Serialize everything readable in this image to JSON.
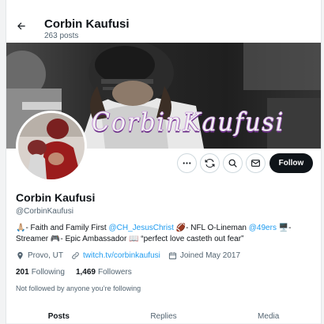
{
  "header": {
    "title": "Corbin Kaufusi",
    "posts_count": "263 posts"
  },
  "banner": {
    "signature_text": "CorbinKaufusi"
  },
  "actions": {
    "follow_label": "Follow"
  },
  "profile": {
    "name": "Corbin Kaufusi",
    "handle": "@CorbinKaufusi",
    "bio": {
      "part1": "🙏🏼- Faith and Family First ",
      "mention1": "@CH_JesusChrist",
      "part2": " 🏈- NFL O-Lineman ",
      "mention2": "@49ers",
      "part3": " 🖥️- Streamer 🎮- Epic Ambassador 📖 “perfect love casteth out fear”"
    },
    "location": "Provo, UT",
    "website": "twitch.tv/corbinkaufusi",
    "joined": "Joined May 2017",
    "following_count": "201",
    "following_label": "Following",
    "followers_count": "1,469",
    "followers_label": "Followers",
    "followed_by_note": "Not followed by anyone you’re following"
  },
  "tabs": [
    {
      "label": "Posts",
      "active": true
    },
    {
      "label": "Replies",
      "active": false
    },
    {
      "label": "Media",
      "active": false
    }
  ],
  "colors": {
    "accent": "#1d9bf0",
    "text_primary": "#0f1419",
    "text_secondary": "#536471",
    "follow_button_bg": "#0f1419",
    "signature_glow": "#8e4aa8"
  },
  "icons": [
    "back-arrow-icon",
    "more-icon",
    "subscribe-icon",
    "search-icon",
    "message-icon",
    "location-icon",
    "link-icon",
    "calendar-icon"
  ]
}
